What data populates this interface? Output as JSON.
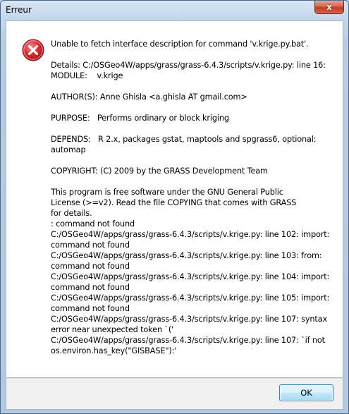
{
  "window": {
    "title": "Erreur",
    "close_label": "x"
  },
  "dialog": {
    "icon": "error-icon",
    "lines": [
      "Unable to fetch interface description for command 'v.krige.py.bat'.",
      "",
      "Details: C:/OSGeo4W/apps/grass/grass-6.4.3/scripts/v.krige.py: line 16:",
      "MODULE:    v.krige",
      "",
      "AUTHOR(S): Anne Ghisla <a.ghisla AT gmail.com>",
      "",
      "PURPOSE:   Performs ordinary or block kriging",
      "",
      "DEPENDS:   R 2.x, packages gstat, maptools and spgrass6, optional:",
      "automap",
      "",
      "COPYRIGHT: (C) 2009 by the GRASS Development Team",
      "",
      "This program is free software under the GNU General Public",
      "License (>=v2). Read the file COPYING that comes with GRASS",
      "for details.",
      ": command not found",
      "C:/OSGeo4W/apps/grass/grass-6.4.3/scripts/v.krige.py: line 102: import:",
      "command not found",
      "C:/OSGeo4W/apps/grass/grass-6.4.3/scripts/v.krige.py: line 103: from:",
      "command not found",
      "C:/OSGeo4W/apps/grass/grass-6.4.3/scripts/v.krige.py: line 104: import:",
      "command not found",
      "C:/OSGeo4W/apps/grass/grass-6.4.3/scripts/v.krige.py: line 105: import:",
      "command not found",
      "C:/OSGeo4W/apps/grass/grass-6.4.3/scripts/v.krige.py: line 107: syntax",
      "error near unexpected token `('",
      "C:/OSGeo4W/apps/grass/grass-6.4.3/scripts/v.krige.py: line 107: `if not",
      "os.environ.has_key(\"GISBASE\"):'"
    ]
  },
  "footer": {
    "ok_label": "OK"
  },
  "colors": {
    "error_red": "#d9262b",
    "accent_blue": "#3c7fb1"
  }
}
